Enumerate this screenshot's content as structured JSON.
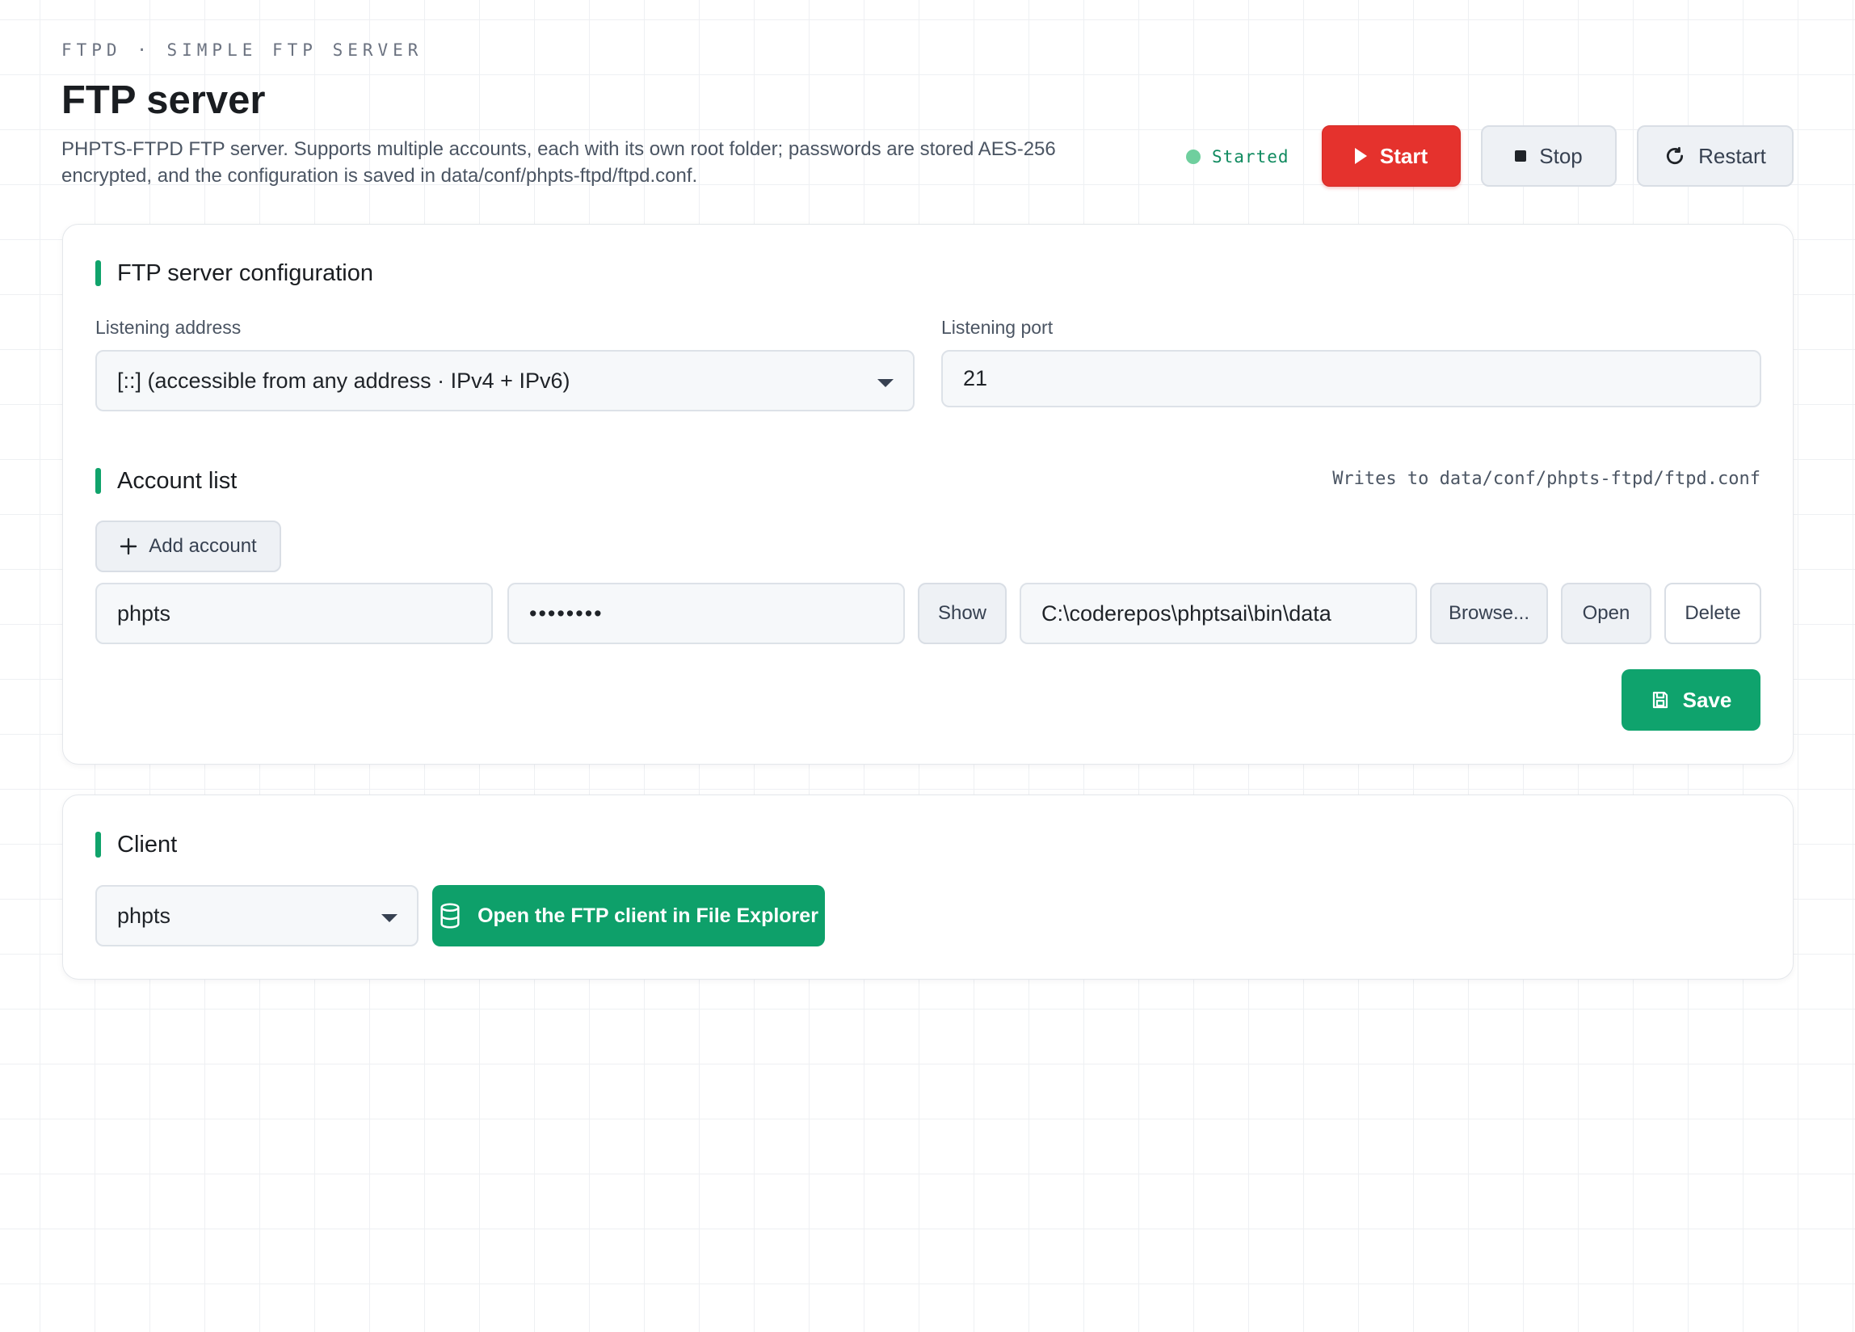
{
  "header": {
    "eyebrow": "FTPD · SIMPLE FTP SERVER",
    "title": "FTP server",
    "description_line1": "PHPTS-FTPD FTP server. Supports multiple accounts, each with its own root folder; passwords are stored AES-256",
    "description_line2": "encrypted, and the configuration is saved in data/conf/phpts-ftpd/ftpd.conf."
  },
  "status": {
    "text": "Started",
    "color": "#6fcf9e"
  },
  "controls": {
    "start_label": "Start",
    "stop_label": "Stop",
    "restart_label": "Restart"
  },
  "config": {
    "section_title": "FTP server configuration",
    "address_label": "Listening address",
    "address_value": "[::] (accessible from any address · IPv4 + IPv6)",
    "port_label": "Listening port",
    "port_value": "21"
  },
  "accounts": {
    "section_title": "Account list",
    "writes_to": "Writes to data/conf/phpts-ftpd/ftpd.conf",
    "add_label": "Add account",
    "rows": [
      {
        "username": "phpts",
        "password_mask": "••••••••",
        "show_label": "Show",
        "root_folder": "C:\\coderepos\\phptsai\\bin\\data",
        "browse_label": "Browse...",
        "open_label": "Open",
        "delete_label": "Delete"
      }
    ],
    "save_label": "Save"
  },
  "client": {
    "section_title": "Client",
    "account_value": "phpts",
    "open_label": "Open the FTP client in File Explorer"
  },
  "colors": {
    "accent_green": "#10a36b",
    "start_red": "#e5322d"
  },
  "icons": {
    "start": "play-icon",
    "stop": "stop-icon",
    "restart": "restart-icon",
    "add": "plus-icon",
    "save": "save-icon",
    "client": "database-icon"
  }
}
